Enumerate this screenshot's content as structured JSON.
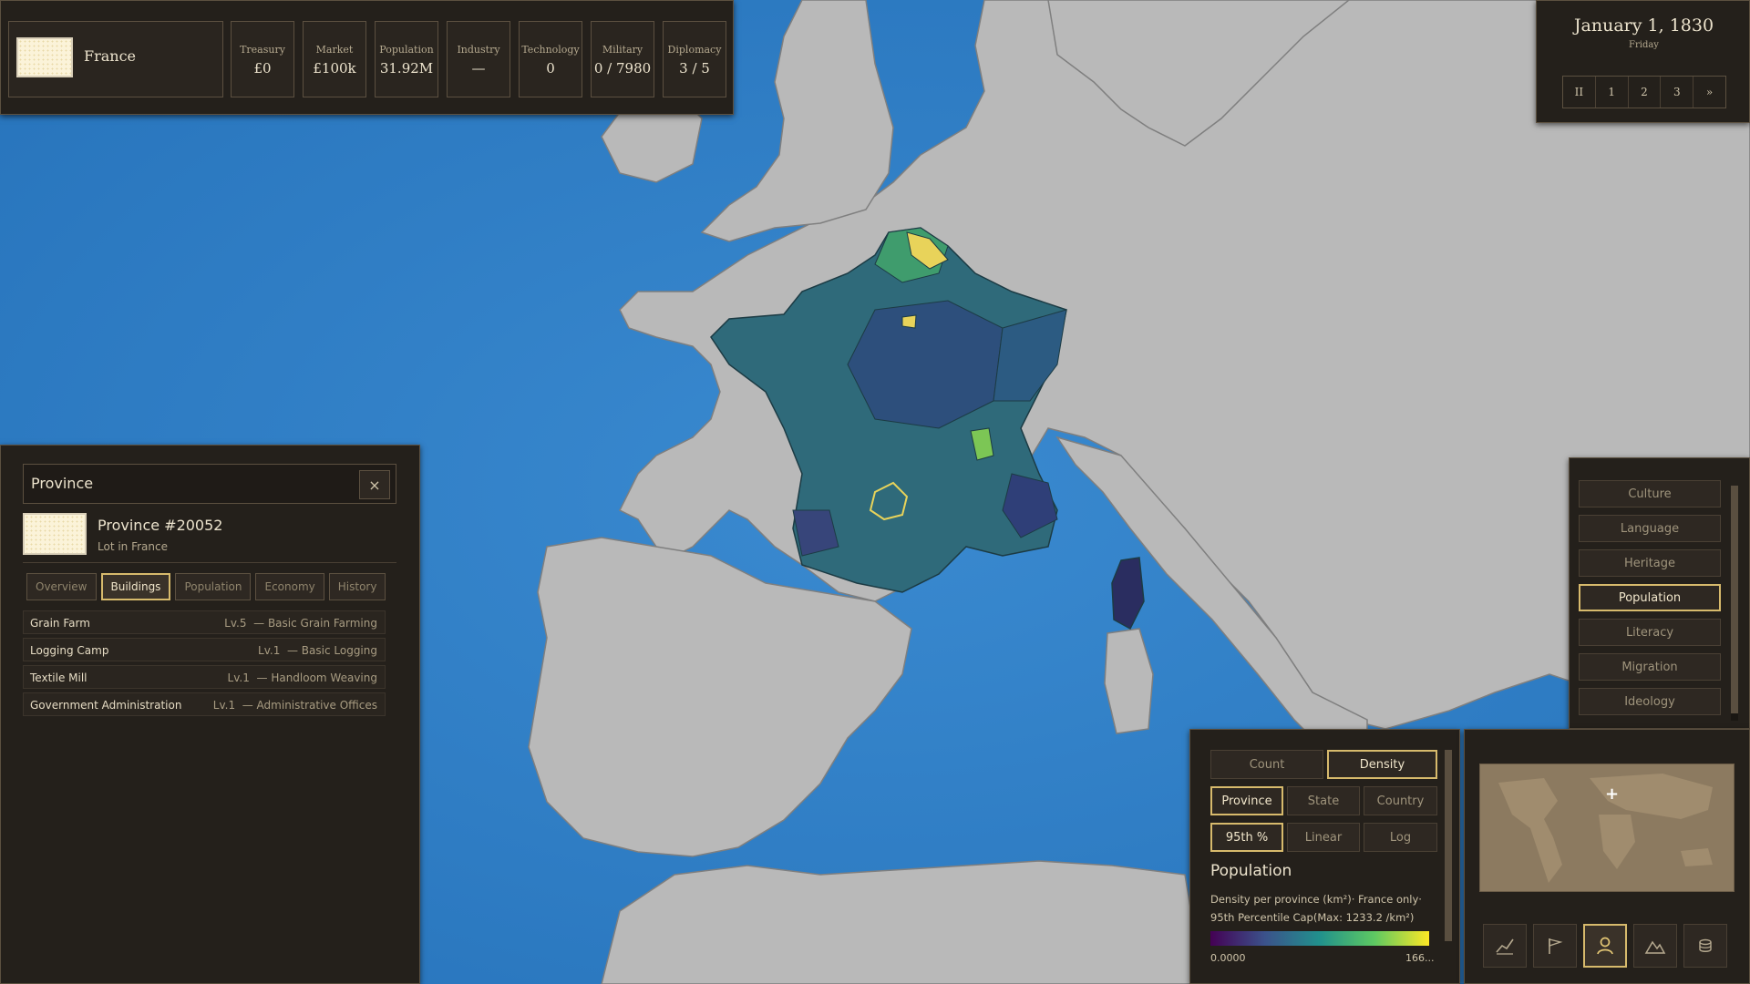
{
  "topbar": {
    "country_name": "France",
    "stats": [
      {
        "label": "Treasury",
        "value": "£0"
      },
      {
        "label": "Market",
        "value": "£100k"
      },
      {
        "label": "Population",
        "value": "31.92M"
      },
      {
        "label": "Industry",
        "value": "—"
      },
      {
        "label": "Technology",
        "value": "0"
      },
      {
        "label": "Military",
        "value": "0 / 7980"
      },
      {
        "label": "Diplomacy",
        "value": "3 / 5"
      }
    ]
  },
  "date": {
    "main": "January 1, 1830",
    "weekday": "Friday",
    "speed_buttons": [
      "II",
      "1",
      "2",
      "3",
      "»"
    ]
  },
  "province_panel": {
    "header": "Province",
    "close_icon": "×",
    "name": "Province #20052",
    "subtitle": "Lot in France",
    "tabs": [
      "Overview",
      "Buildings",
      "Population",
      "Economy",
      "History"
    ],
    "active_tab": "Buildings",
    "buildings": [
      {
        "name": "Grain Farm",
        "level": "Lv.5",
        "method": "— Basic Grain Farming"
      },
      {
        "name": "Logging Camp",
        "level": "Lv.1",
        "method": "— Basic Logging"
      },
      {
        "name": "Textile Mill",
        "level": "Lv.1",
        "method": "— Handloom Weaving"
      },
      {
        "name": "Government Administration",
        "level": "Lv.1",
        "method": "— Administrative Offices"
      }
    ]
  },
  "layers": {
    "items": [
      "Culture",
      "Language",
      "Heritage",
      "Population",
      "Literacy",
      "Migration",
      "Ideology"
    ],
    "active": "Population"
  },
  "legend": {
    "mode_buttons": [
      "Count",
      "Density"
    ],
    "scope_buttons": [
      "Province",
      "State",
      "Country"
    ],
    "scale_buttons": [
      "95th %",
      "Linear",
      "Log"
    ],
    "active": [
      "Density",
      "Province",
      "95th %"
    ],
    "title": "Population",
    "description_line1": "Density per province (km²)· France only·",
    "description_line2": "95th Percentile Cap(Max: 1233.2 /km²)",
    "min_label": "0.0000",
    "max_label": "166...",
    "colors": [
      "#440154",
      "#3b528b",
      "#21918c",
      "#5ec962",
      "#fde725"
    ]
  },
  "minimap": {
    "buttons": [
      "chart-icon",
      "flag-icon",
      "person-icon",
      "mountains-icon",
      "coins-icon"
    ],
    "active": "person-icon"
  },
  "map": {
    "sea_color": "#2d7ec4",
    "land_color": "#b9b9b9",
    "highlight_color": "#e8d35a"
  }
}
